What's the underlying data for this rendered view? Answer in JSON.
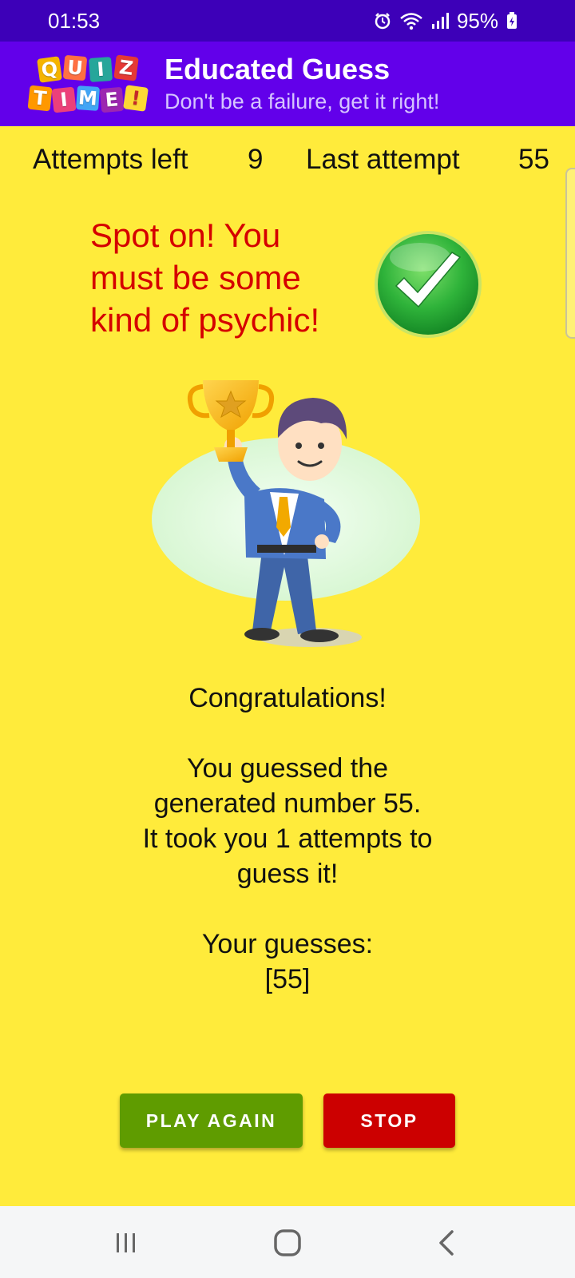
{
  "status_bar": {
    "time": "01:53",
    "battery": "95%"
  },
  "app_bar": {
    "logo_tiles": [
      "Q",
      "U",
      "I",
      "Z",
      "T",
      "I",
      "M",
      "E",
      "!"
    ],
    "title": "Educated Guess",
    "subtitle": "Don't be a failure, get it right!"
  },
  "stats": {
    "attempts_left_label": "Attempts left",
    "attempts_left_value": "9",
    "last_attempt_label": "Last attempt",
    "last_attempt_value": "55"
  },
  "result": {
    "message": "Spot on! You must be some kind of psychic!"
  },
  "summary": {
    "heading": "Congratulations!",
    "line1": "You guessed the",
    "line2": "generated number 55.",
    "line3": "It took you 1 attempts to",
    "line4": "guess it!",
    "guesses_label": "Your guesses:",
    "guesses_value": "[55]"
  },
  "buttons": {
    "play_again": "PLAY AGAIN",
    "stop": "STOP"
  },
  "colors": {
    "status_bar": "#3d00b8",
    "app_bar": "#6200ea",
    "background": "#ffeb3b",
    "result_text": "#d50000",
    "play_again": "#5f9c00",
    "stop": "#cc0000"
  },
  "icons": [
    "alarm-icon",
    "wifi-icon",
    "signal-icon",
    "battery-charging-icon",
    "checkmark-badge-icon",
    "recent-apps-icon",
    "home-icon",
    "back-icon"
  ]
}
